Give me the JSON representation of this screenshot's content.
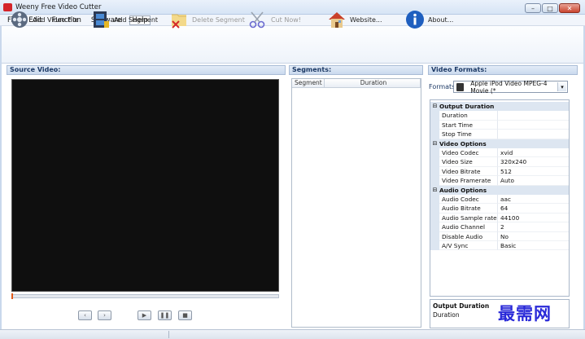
{
  "window": {
    "title": "Weeny Free Video Cutter",
    "minimize": "–",
    "maximize": "□",
    "close": "✕"
  },
  "menu": [
    {
      "label": "File"
    },
    {
      "label": "Edit"
    },
    {
      "label": "Function"
    },
    {
      "label": "Software"
    },
    {
      "label": "Help"
    }
  ],
  "toolbar": {
    "add_video": "Add Video File",
    "add_segment": "Add Segment",
    "delete_segment": "Delete Segment",
    "cut_now": "Cut Now!",
    "website": "Website...",
    "about": "About..."
  },
  "panels": {
    "source": "Source Video:",
    "segments": "Segments:",
    "formats": "Video Formats:"
  },
  "segments": {
    "col_segment": "Segment",
    "col_duration": "Duration"
  },
  "playback": {
    "prev": "‹",
    "next": "›",
    "play": "▶",
    "pause": "❚❚",
    "stop": "■"
  },
  "formats": {
    "label": "Formats:",
    "selected": "Apple iPod Video MPEG-4 Movie (*"
  },
  "properties": {
    "output_duration": {
      "title": "Output Duration",
      "rows": [
        {
          "k": "Duration",
          "v": ""
        },
        {
          "k": "Start Time",
          "v": ""
        },
        {
          "k": "Stop Time",
          "v": ""
        }
      ]
    },
    "video_options": {
      "title": "Video Options",
      "rows": [
        {
          "k": "Video Codec",
          "v": "xvid"
        },
        {
          "k": "Video Size",
          "v": "320x240"
        },
        {
          "k": "Video Bitrate",
          "v": "512"
        },
        {
          "k": "Video Framerate",
          "v": "Auto"
        }
      ]
    },
    "audio_options": {
      "title": "Audio Options",
      "rows": [
        {
          "k": "Audio Codec",
          "v": "aac"
        },
        {
          "k": "Audio Bitrate",
          "v": "64"
        },
        {
          "k": "Audio Sample rate",
          "v": "44100"
        },
        {
          "k": "Audio Channel",
          "v": "2"
        },
        {
          "k": "Disable Audio",
          "v": "No"
        },
        {
          "k": "A/V Sync",
          "v": "Basic"
        }
      ]
    }
  },
  "description": {
    "title": "Output Duration",
    "text": "Duration"
  },
  "watermark": "最需网",
  "colors": {
    "accent": "#1d3a66",
    "video_bg": "#0f0f0f",
    "watermark": "#2a2ad8"
  }
}
